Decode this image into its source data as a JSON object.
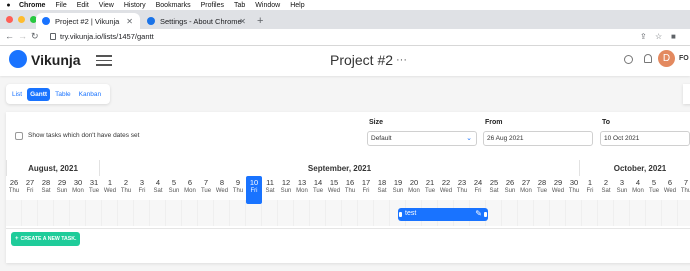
{
  "menubar": {
    "items": [
      "Chrome",
      "File",
      "Edit",
      "View",
      "History",
      "Bookmarks",
      "Profiles",
      "Tab",
      "Window",
      "Help"
    ]
  },
  "tabs": [
    {
      "title": "Project #2 | Vikunja",
      "active": true
    },
    {
      "title": "Settings - About Chrome",
      "active": false
    }
  ],
  "toolbar": {
    "url": "try.vikunja.io/lists/1457/gantt"
  },
  "header": {
    "brand": "Vikunja",
    "title": "Project #2",
    "menu_dots": "···",
    "avatar_letter": "D",
    "user": "FO"
  },
  "views": {
    "items": [
      "List",
      "Gantt",
      "Table",
      "Kanban"
    ],
    "active": "Gantt"
  },
  "filters": {
    "show_undated_label": "Show tasks which don't have dates set",
    "size_label": "Size",
    "size_value": "Default",
    "from_label": "From",
    "from_value": "26 Aug 2021",
    "to_label": "To",
    "to_value": "10 Oct 2021"
  },
  "gantt": {
    "months": [
      "August, 2021",
      "September, 2021",
      "October, 2021"
    ],
    "days": [
      {
        "d": "26",
        "w": "Thu"
      },
      {
        "d": "27",
        "w": "Fri"
      },
      {
        "d": "28",
        "w": "Sat"
      },
      {
        "d": "29",
        "w": "Sun"
      },
      {
        "d": "30",
        "w": "Mon"
      },
      {
        "d": "31",
        "w": "Tue"
      },
      {
        "d": "1",
        "w": "Wed"
      },
      {
        "d": "2",
        "w": "Thu"
      },
      {
        "d": "3",
        "w": "Fri"
      },
      {
        "d": "4",
        "w": "Sat"
      },
      {
        "d": "5",
        "w": "Sun"
      },
      {
        "d": "6",
        "w": "Mon"
      },
      {
        "d": "7",
        "w": "Tue"
      },
      {
        "d": "8",
        "w": "Wed"
      },
      {
        "d": "9",
        "w": "Thu"
      },
      {
        "d": "10",
        "w": "Fri"
      },
      {
        "d": "11",
        "w": "Sat"
      },
      {
        "d": "12",
        "w": "Sun"
      },
      {
        "d": "13",
        "w": "Mon"
      },
      {
        "d": "14",
        "w": "Tue"
      },
      {
        "d": "15",
        "w": "Wed"
      },
      {
        "d": "16",
        "w": "Thu"
      },
      {
        "d": "17",
        "w": "Fri"
      },
      {
        "d": "18",
        "w": "Sat"
      },
      {
        "d": "19",
        "w": "Sun"
      },
      {
        "d": "20",
        "w": "Mon"
      },
      {
        "d": "21",
        "w": "Tue"
      },
      {
        "d": "22",
        "w": "Wed"
      },
      {
        "d": "23",
        "w": "Thu"
      },
      {
        "d": "24",
        "w": "Fri"
      },
      {
        "d": "25",
        "w": "Sat"
      },
      {
        "d": "26",
        "w": "Sun"
      },
      {
        "d": "27",
        "w": "Mon"
      },
      {
        "d": "28",
        "w": "Tue"
      },
      {
        "d": "29",
        "w": "Wed"
      },
      {
        "d": "30",
        "w": "Thu"
      },
      {
        "d": "1",
        "w": "Fri"
      },
      {
        "d": "2",
        "w": "Sat"
      },
      {
        "d": "3",
        "w": "Sun"
      },
      {
        "d": "4",
        "w": "Mon"
      },
      {
        "d": "5",
        "w": "Tue"
      },
      {
        "d": "6",
        "w": "Wed"
      },
      {
        "d": "7",
        "w": "Thu"
      },
      {
        "d": "8",
        "w": "Fri"
      }
    ],
    "today": "10",
    "task": {
      "title": "test"
    }
  },
  "create_button": "CREATE A NEW TASK.",
  "colors": {
    "primary": "#1973ff",
    "success": "#1fcc9a"
  }
}
